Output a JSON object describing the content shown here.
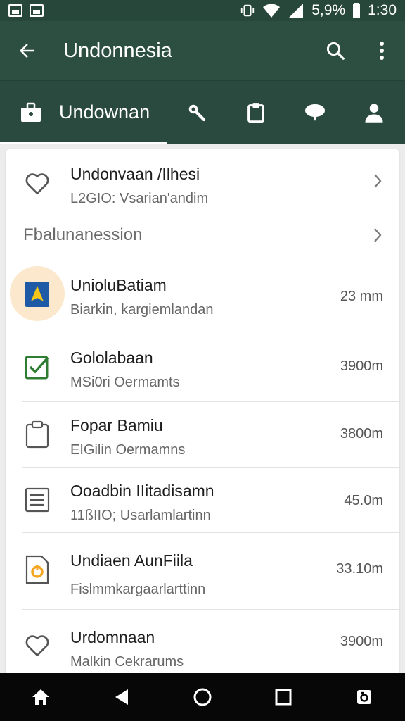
{
  "status_bar": {
    "battery": "5,9%",
    "time": "1:30"
  },
  "app_bar": {
    "title": "Undonnesia",
    "icons": [
      "back-arrow-icon",
      "search-icon",
      "more-vert-icon"
    ]
  },
  "tabs": {
    "active_label": "Undownan",
    "icons": [
      "briefcase-icon",
      "wrench-icon",
      "clipboard-icon",
      "chat-bubble-icon",
      "person-icon"
    ]
  },
  "list": {
    "top_item": {
      "title": "Undonvaan /Ilhesi",
      "subtitle": "L2GIO: Vsarian'andim",
      "icon": "heart-outline-icon"
    },
    "section_header": "Fbalunanession",
    "items": [
      {
        "title": "UnioluBatiam",
        "subtitle": "Biarkin, kargiemlandan",
        "meta": "23 mm",
        "icon": "document-arrow-icon"
      },
      {
        "title": "Gololabaan",
        "subtitle": "MSi0ri Oermamts",
        "meta": "3900m",
        "icon": "checkbox-icon"
      },
      {
        "title": "Fopar Bamiu",
        "subtitle": "EIGilin Oermamns",
        "meta": "3800m",
        "icon": "clipboard-outline-icon"
      },
      {
        "title": "Ooadbin IIitadisamn",
        "subtitle": "11ßIIO; Usarlamlartinn",
        "meta": "45.0m",
        "icon": "notes-icon"
      },
      {
        "title": "Undiaen AunFiila",
        "subtitle": "Fislmmkargaarlarttinn",
        "meta": "33.10m",
        "icon": "file-orange-icon"
      },
      {
        "title": "Urdomnaan",
        "subtitle": "Malkin Cekrarums",
        "meta": "3900m",
        "icon": "heart-outline-icon"
      }
    ]
  },
  "nav_bar": {
    "icons": [
      "home-icon",
      "back-triangle-icon",
      "home-circle-icon",
      "recents-square-icon",
      "screenshot-icon"
    ]
  },
  "colors": {
    "app_bar": "#2c4f42",
    "status_bar": "#27473b",
    "accent_green": "#2e7d32",
    "accent_blue": "#1f5aa6",
    "accent_orange": "#f5a623"
  }
}
